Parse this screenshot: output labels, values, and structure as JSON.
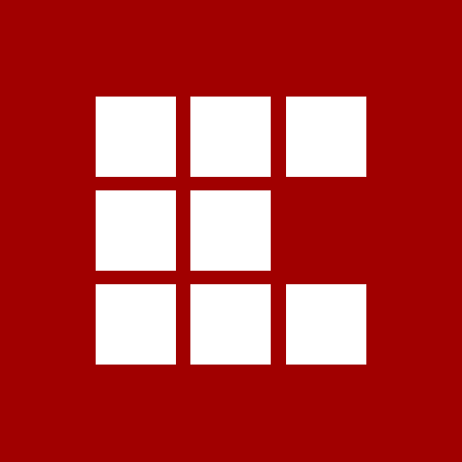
{
  "icon": {
    "name": "grid-logo-icon",
    "background_color": "#a10000",
    "tile_color": "#ffffff",
    "pattern": [
      [
        1,
        1,
        1
      ],
      [
        1,
        1,
        0
      ],
      [
        1,
        1,
        1
      ]
    ]
  }
}
